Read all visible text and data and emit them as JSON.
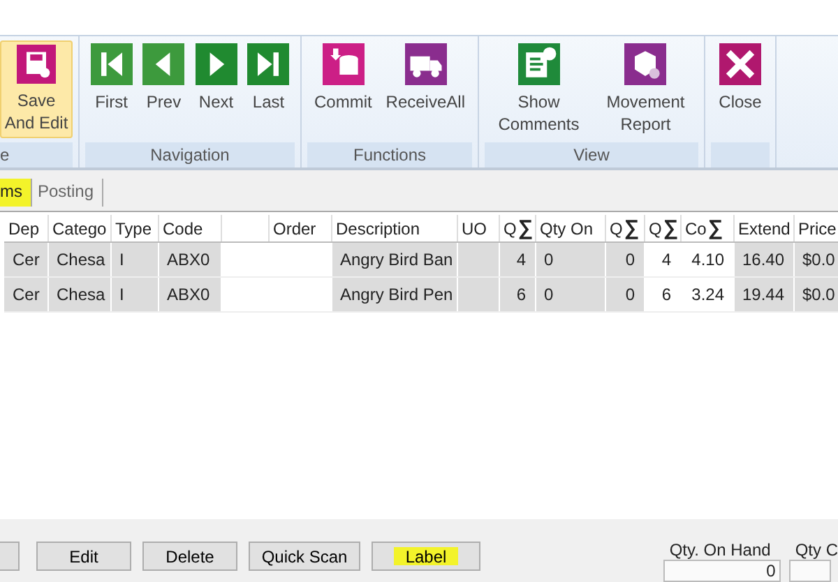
{
  "ribbon": {
    "groups": [
      {
        "label": "e",
        "buttons": [
          {
            "lines": [
              "Save",
              "And Edit"
            ],
            "selected": true
          }
        ]
      },
      {
        "label": "Navigation",
        "buttons": [
          {
            "lines": [
              "First"
            ],
            "selected": false
          },
          {
            "lines": [
              "Prev"
            ],
            "selected": false
          },
          {
            "lines": [
              "Next"
            ],
            "selected": false
          },
          {
            "lines": [
              "Last"
            ],
            "selected": false
          }
        ]
      },
      {
        "label": "Functions",
        "buttons": [
          {
            "lines": [
              "Commit"
            ],
            "selected": false
          },
          {
            "lines": [
              "ReceiveAll"
            ],
            "selected": false
          }
        ]
      },
      {
        "label": "View",
        "buttons": [
          {
            "lines": [
              "Show",
              "Comments"
            ],
            "selected": false
          },
          {
            "lines": [
              "Movement",
              "Report"
            ],
            "selected": false
          }
        ]
      },
      {
        "buttons": [
          {
            "lines": [
              "Close"
            ],
            "selected": false
          }
        ]
      }
    ]
  },
  "tabs": [
    {
      "label": "ms",
      "selected": true,
      "highlighted": true
    },
    {
      "label": "Posting",
      "selected": false,
      "highlighted": false
    }
  ],
  "grid": {
    "columns": [
      {
        "label": "Dep",
        "kind": "text",
        "shaded": true
      },
      {
        "label": "Catego",
        "kind": "text",
        "shaded": true
      },
      {
        "label": "Type",
        "kind": "text",
        "shaded": true
      },
      {
        "label": "Code",
        "kind": "text",
        "shaded": true
      },
      {
        "kind": "text",
        "shaded": false
      },
      {
        "label": "Order",
        "kind": "text",
        "shaded": false
      },
      {
        "label": "Description",
        "kind": "text",
        "shaded": true
      },
      {
        "label": "UO",
        "kind": "text",
        "shaded": true
      },
      {
        "label": "Q",
        "sum": "∑",
        "kind": "number",
        "shaded": true
      },
      {
        "label": "Qty On",
        "kind": "text",
        "shaded": true
      },
      {
        "label": "Q",
        "sum": "∑",
        "kind": "number",
        "shaded": true
      },
      {
        "label": "Q",
        "sum": "∑",
        "kind": "number",
        "shaded": false
      },
      {
        "label": "Co",
        "sum": "∑",
        "kind": "number",
        "shaded": false
      },
      {
        "label": "Extend",
        "kind": "number",
        "shaded": true
      },
      {
        "label": "Price",
        "kind": "text",
        "shaded": true
      }
    ],
    "rows": [
      [
        "Cer",
        "Chesa",
        "I",
        "ABX0",
        null,
        null,
        "Angry Bird Ban",
        null,
        "4",
        "0",
        "0",
        "4",
        "4.10",
        "16.40",
        "$0.0"
      ],
      [
        "Cer",
        "Chesa",
        "I",
        "ABX0",
        null,
        null,
        "Angry Bird Pen",
        null,
        "6",
        "0",
        "0",
        "6",
        "3.24",
        "19.44",
        "$0.0"
      ]
    ]
  },
  "buttons": [
    {
      "kind": "cut"
    },
    {
      "label": "Edit",
      "kind": "button",
      "highlighted": false
    },
    {
      "label": "Delete",
      "kind": "button",
      "highlighted": false
    },
    {
      "label": "Quick Scan",
      "kind": "button",
      "highlighted": false
    },
    {
      "label": "Label",
      "kind": "button",
      "highlighted": true
    }
  ],
  "fields": [
    {
      "label": "Qty. On Hand",
      "value": "0"
    },
    {
      "label": "Qty C"
    }
  ]
}
